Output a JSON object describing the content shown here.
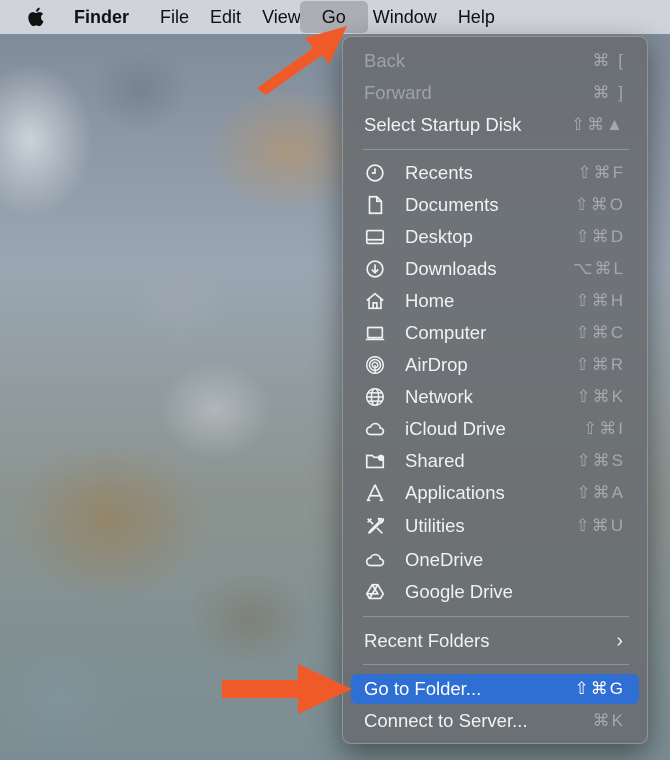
{
  "menubar": {
    "apple": "apple-logo-icon",
    "items": [
      {
        "label": "Finder"
      },
      {
        "label": "File"
      },
      {
        "label": "Edit"
      },
      {
        "label": "View"
      },
      {
        "label": "Go"
      },
      {
        "label": "Window"
      },
      {
        "label": "Help"
      }
    ]
  },
  "go_menu": {
    "back": {
      "label": "Back",
      "shortcut": "⌘ ["
    },
    "forward": {
      "label": "Forward",
      "shortcut": "⌘ ]"
    },
    "startup": {
      "label": "Select Startup Disk",
      "shortcut": "⇧⌘▲"
    },
    "locations": [
      {
        "label": "Recents",
        "shortcut": "⇧⌘F",
        "icon": "clock-icon"
      },
      {
        "label": "Documents",
        "shortcut": "⇧⌘O",
        "icon": "document-icon"
      },
      {
        "label": "Desktop",
        "shortcut": "⇧⌘D",
        "icon": "desktop-icon"
      },
      {
        "label": "Downloads",
        "shortcut": "⌥⌘L",
        "icon": "download-icon"
      },
      {
        "label": "Home",
        "shortcut": "⇧⌘H",
        "icon": "home-icon"
      },
      {
        "label": "Computer",
        "shortcut": "⇧⌘C",
        "icon": "laptop-icon"
      },
      {
        "label": "AirDrop",
        "shortcut": "⇧⌘R",
        "icon": "airdrop-icon"
      },
      {
        "label": "Network",
        "shortcut": "⇧⌘K",
        "icon": "globe-icon"
      },
      {
        "label": "iCloud Drive",
        "shortcut": "⇧⌘I",
        "icon": "cloud-icon"
      },
      {
        "label": "Shared",
        "shortcut": "⇧⌘S",
        "icon": "shared-folder-icon"
      },
      {
        "label": "Applications",
        "shortcut": "⇧⌘A",
        "icon": "applications-icon"
      },
      {
        "label": "Utilities",
        "shortcut": "⇧⌘U",
        "icon": "tools-icon"
      },
      {
        "label": "OneDrive",
        "shortcut": "",
        "icon": "cloud-icon"
      },
      {
        "label": "Google Drive",
        "shortcut": "",
        "icon": "google-drive-icon"
      }
    ],
    "recent_folders": {
      "label": "Recent Folders",
      "chevron": "›"
    },
    "go_to_folder": {
      "label": "Go to Folder...",
      "shortcut": "⇧⌘G"
    },
    "connect": {
      "label": "Connect to Server...",
      "shortcut": "⌘K"
    }
  },
  "annotations": {
    "arrow_color": "#f05a28",
    "highlight_color": "#2f6fd3"
  }
}
